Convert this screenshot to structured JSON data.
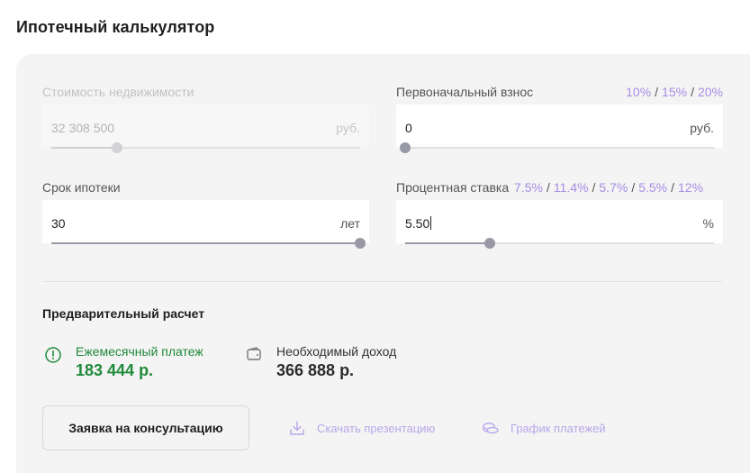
{
  "page": {
    "title": "Ипотечный калькулятор"
  },
  "price": {
    "label": "Стоимость недвижимости",
    "value": "32 308 500",
    "unit": "руб.",
    "slider_fraction": 0.2
  },
  "down_payment": {
    "label": "Первоначальный взнос",
    "value": "0",
    "unit": "руб.",
    "slider_fraction": 0.0,
    "quick_options": [
      "10%",
      "15%",
      "20%"
    ],
    "separator": "/"
  },
  "term": {
    "label": "Срок ипотеки",
    "value": "30",
    "unit": "лет",
    "slider_fraction": 1.0
  },
  "rate": {
    "label": "Процентная ставка",
    "value": "5.50",
    "unit": "%",
    "slider_fraction": 0.27,
    "quick_options": [
      "7.5%",
      "11.4%",
      "5.7%",
      "5.5%",
      "12%"
    ],
    "separator": "/"
  },
  "summary": {
    "title": "Предварительный расчет",
    "monthly": {
      "label": "Ежемесячный платеж",
      "value": "183 444 р."
    },
    "income": {
      "label": "Необходимый доход",
      "value": "366 888 р."
    }
  },
  "actions": {
    "consult_label": "Заявка на консультацию",
    "download_label": "Скачать презентацию",
    "schedule_label": "График платежей"
  },
  "colors": {
    "accent_green": "#1f8a3a",
    "accent_purple": "#a58ee3",
    "slider_thumb": "#9898a6"
  }
}
